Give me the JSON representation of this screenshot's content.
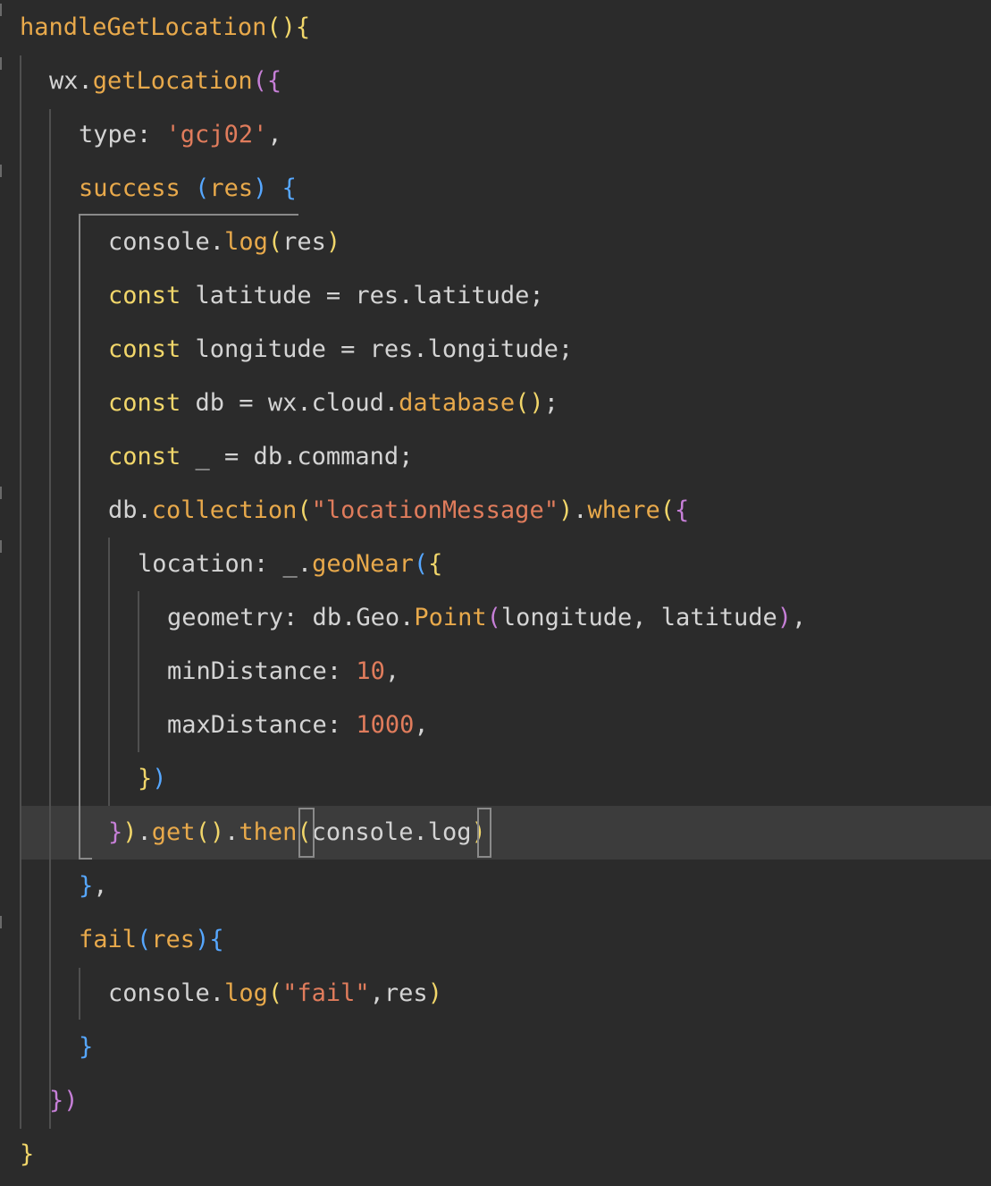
{
  "editor": {
    "theme": {
      "background": "#2b2b2b",
      "current_line": "#3c3c3c",
      "plain": "#d4d4d4",
      "function": "#e8a94b",
      "keyword": "#f1d66a",
      "string": "#e07c5c",
      "number": "#e07c5c",
      "bracket_1": "#f1d66a",
      "bracket_2": "#c67fd7",
      "bracket_3": "#56a7ff",
      "param": "#e8a94b"
    },
    "lines": [
      [
        {
          "t": "handleGetLocation",
          "c": "function"
        },
        {
          "t": "()",
          "c": "bracket_1"
        },
        {
          "t": "{",
          "c": "bracket_1"
        }
      ],
      [
        {
          "t": "wx",
          "c": "plain"
        },
        {
          "t": ".",
          "c": "plain"
        },
        {
          "t": "getLocation",
          "c": "function"
        },
        {
          "t": "(",
          "c": "bracket_2"
        },
        {
          "t": "{",
          "c": "bracket_2"
        }
      ],
      [
        {
          "t": "type",
          "c": "plain"
        },
        {
          "t": ": ",
          "c": "plain"
        },
        {
          "t": "'gcj02'",
          "c": "string"
        },
        {
          "t": ",",
          "c": "plain"
        }
      ],
      [
        {
          "t": "success",
          "c": "function"
        },
        {
          "t": " ",
          "c": "plain"
        },
        {
          "t": "(",
          "c": "bracket_3"
        },
        {
          "t": "res",
          "c": "param"
        },
        {
          "t": ")",
          "c": "bracket_3"
        },
        {
          "t": " ",
          "c": "plain"
        },
        {
          "t": "{",
          "c": "bracket_3"
        }
      ],
      [
        {
          "t": "console",
          "c": "plain"
        },
        {
          "t": ".",
          "c": "plain"
        },
        {
          "t": "log",
          "c": "function"
        },
        {
          "t": "(",
          "c": "bracket_1"
        },
        {
          "t": "res",
          "c": "plain"
        },
        {
          "t": ")",
          "c": "bracket_1"
        }
      ],
      [
        {
          "t": "const",
          "c": "keyword"
        },
        {
          "t": " latitude = res.latitude;",
          "c": "plain"
        }
      ],
      [
        {
          "t": "const",
          "c": "keyword"
        },
        {
          "t": " longitude = res.longitude;",
          "c": "plain"
        }
      ],
      [
        {
          "t": "const",
          "c": "keyword"
        },
        {
          "t": " db = wx.cloud.",
          "c": "plain"
        },
        {
          "t": "database",
          "c": "function"
        },
        {
          "t": "()",
          "c": "bracket_1"
        },
        {
          "t": ";",
          "c": "plain"
        }
      ],
      [
        {
          "t": "const",
          "c": "keyword"
        },
        {
          "t": " _ = db.command;",
          "c": "plain"
        }
      ],
      [
        {
          "t": "db",
          "c": "plain"
        },
        {
          "t": ".",
          "c": "plain"
        },
        {
          "t": "collection",
          "c": "function"
        },
        {
          "t": "(",
          "c": "bracket_1"
        },
        {
          "t": "\"locationMessage\"",
          "c": "string"
        },
        {
          "t": ")",
          "c": "bracket_1"
        },
        {
          "t": ".",
          "c": "plain"
        },
        {
          "t": "where",
          "c": "function"
        },
        {
          "t": "(",
          "c": "bracket_1"
        },
        {
          "t": "{",
          "c": "bracket_2"
        }
      ],
      [
        {
          "t": "location",
          "c": "plain"
        },
        {
          "t": ": _.",
          "c": "plain"
        },
        {
          "t": "geoNear",
          "c": "function"
        },
        {
          "t": "(",
          "c": "bracket_3"
        },
        {
          "t": "{",
          "c": "bracket_1"
        }
      ],
      [
        {
          "t": "geometry",
          "c": "plain"
        },
        {
          "t": ": db.Geo.",
          "c": "plain"
        },
        {
          "t": "Point",
          "c": "function"
        },
        {
          "t": "(",
          "c": "bracket_2"
        },
        {
          "t": "longitude, latitude",
          "c": "plain"
        },
        {
          "t": ")",
          "c": "bracket_2"
        },
        {
          "t": ",",
          "c": "plain"
        }
      ],
      [
        {
          "t": "minDistance",
          "c": "plain"
        },
        {
          "t": ": ",
          "c": "plain"
        },
        {
          "t": "10",
          "c": "number"
        },
        {
          "t": ",",
          "c": "plain"
        }
      ],
      [
        {
          "t": "maxDistance",
          "c": "plain"
        },
        {
          "t": ": ",
          "c": "plain"
        },
        {
          "t": "1000",
          "c": "number"
        },
        {
          "t": ",",
          "c": "plain"
        }
      ],
      [
        {
          "t": "}",
          "c": "bracket_1"
        },
        {
          "t": ")",
          "c": "bracket_3"
        }
      ],
      [
        {
          "t": "}",
          "c": "bracket_2"
        },
        {
          "t": ")",
          "c": "bracket_1"
        },
        {
          "t": ".",
          "c": "plain"
        },
        {
          "t": "get",
          "c": "function"
        },
        {
          "t": "()",
          "c": "bracket_1"
        },
        {
          "t": ".",
          "c": "plain"
        },
        {
          "t": "then",
          "c": "function"
        },
        {
          "t": "(",
          "c": "bracket_1"
        },
        {
          "t": "console.log",
          "c": "plain"
        },
        {
          "t": ")",
          "c": "bracket_1"
        }
      ],
      [
        {
          "t": "}",
          "c": "bracket_3"
        },
        {
          "t": ",",
          "c": "plain"
        }
      ],
      [
        {
          "t": "fail",
          "c": "function"
        },
        {
          "t": "(",
          "c": "bracket_3"
        },
        {
          "t": "res",
          "c": "param"
        },
        {
          "t": ")",
          "c": "bracket_3"
        },
        {
          "t": "{",
          "c": "bracket_3"
        }
      ],
      [
        {
          "t": "console",
          "c": "plain"
        },
        {
          "t": ".",
          "c": "plain"
        },
        {
          "t": "log",
          "c": "function"
        },
        {
          "t": "(",
          "c": "bracket_1"
        },
        {
          "t": "\"fail\"",
          "c": "string"
        },
        {
          "t": ",res",
          "c": "plain"
        },
        {
          "t": ")",
          "c": "bracket_1"
        }
      ],
      [
        {
          "t": "}",
          "c": "bracket_3"
        }
      ],
      [
        {
          "t": "}",
          "c": "bracket_2"
        },
        {
          "t": ")",
          "c": "bracket_2"
        }
      ],
      [
        {
          "t": "}",
          "c": "bracket_1"
        }
      ]
    ]
  }
}
